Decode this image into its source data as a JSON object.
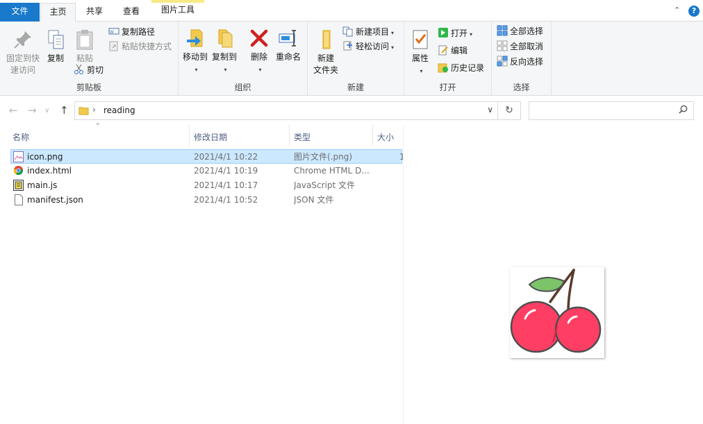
{
  "tabs": {
    "file": "文件",
    "home": "主页",
    "share": "共享",
    "view": "查看",
    "picture_tools": "图片工具"
  },
  "ribbon": {
    "clipboard": {
      "pin": "固定到快速访问",
      "pin_line1": "固定到快",
      "pin_line2": "速访问",
      "copy": "复制",
      "paste": "粘贴",
      "copy_path": "复制路径",
      "paste_shortcut": "粘贴快捷方式",
      "cut": "剪切",
      "label": "剪贴板"
    },
    "organize": {
      "move_to": "移动到",
      "copy_to": "复制到",
      "delete": "删除",
      "rename": "重命名",
      "label": "组织"
    },
    "new": {
      "new_folder_line1": "新建",
      "new_folder_line2": "文件夹",
      "new_item": "新建项目",
      "easy_access": "轻松访问",
      "label": "新建"
    },
    "open": {
      "properties": "属性",
      "open": "打开",
      "edit": "编辑",
      "history": "历史记录",
      "label": "打开"
    },
    "select": {
      "select_all": "全部选择",
      "select_none": "全部取消",
      "invert": "反向选择",
      "label": "选择"
    }
  },
  "address": {
    "path": "reading",
    "search_placeholder": ""
  },
  "columns": {
    "name": "名称",
    "modified": "修改日期",
    "type": "类型",
    "size": "大小"
  },
  "files": [
    {
      "name": "icon.png",
      "modified": "2021/4/1 10:22",
      "type": "图片文件(.png)",
      "size": "1",
      "icon": "image-file-icon"
    },
    {
      "name": "index.html",
      "modified": "2021/4/1 10:19",
      "type": "Chrome HTML D...",
      "size": "",
      "icon": "chrome-icon"
    },
    {
      "name": "main.js",
      "modified": "2021/4/1 10:17",
      "type": "JavaScript 文件",
      "size": "",
      "icon": "js-file-icon"
    },
    {
      "name": "manifest.json",
      "modified": "2021/4/1 10:52",
      "type": "JSON 文件",
      "size": "",
      "icon": "blank-file-icon"
    }
  ],
  "colors": {
    "accent": "#1979ca",
    "selection": "#cce8ff",
    "picture_tools": "#f7e985"
  }
}
